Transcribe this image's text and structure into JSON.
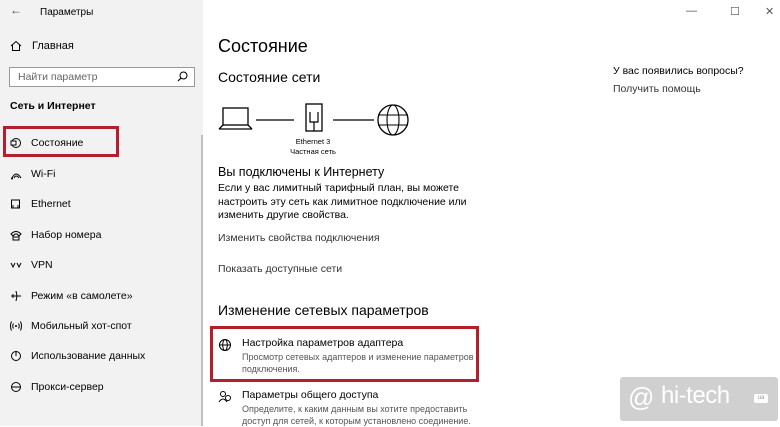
{
  "window": {
    "title": "Параметры",
    "controls": {
      "minimize": "—",
      "maximize": "☐",
      "close": "✕"
    }
  },
  "sidebar": {
    "home_label": "Главная",
    "search_placeholder": "Найти параметр",
    "section_title": "Сеть и Интернет",
    "items": [
      {
        "label": "Состояние",
        "icon": "status-icon",
        "selected": true
      },
      {
        "label": "Wi-Fi",
        "icon": "wifi-icon"
      },
      {
        "label": "Ethernet",
        "icon": "ethernet-icon"
      },
      {
        "label": "Набор номера",
        "icon": "dialup-icon"
      },
      {
        "label": "VPN",
        "icon": "vpn-icon"
      },
      {
        "label": "Режим «в самолете»",
        "icon": "airplane-icon"
      },
      {
        "label": "Мобильный хот-спот",
        "icon": "hotspot-icon"
      },
      {
        "label": "Использование данных",
        "icon": "data-usage-icon"
      },
      {
        "label": "Прокси-сервер",
        "icon": "proxy-icon"
      }
    ],
    "highlight_color": "#b3202b"
  },
  "main": {
    "page_title": "Состояние",
    "network_status_title": "Состояние сети",
    "diagram": {
      "adapter_name": "Ethernet 3",
      "network_type": "Частная сеть"
    },
    "connected_title": "Вы подключены к Интернету",
    "connected_desc": "Если у вас лимитный тарифный план, вы можете настроить эту сеть как лимитное подключение или изменить другие свойства.",
    "links": {
      "change_props": "Изменить свойства подключения",
      "show_networks": "Показать доступные сети"
    },
    "change_settings_title": "Изменение сетевых параметров",
    "options": [
      {
        "title": "Настройка параметров адаптера",
        "desc": "Просмотр сетевых адаптеров и изменение параметров подключения.",
        "icon": "adapter-icon"
      },
      {
        "title": "Параметры общего доступа",
        "desc": "Определите, к каким данным вы хотите предоставить доступ для сетей, к которым установлено соединение.",
        "icon": "sharing-icon"
      }
    ]
  },
  "help": {
    "title": "У вас появились вопросы?",
    "link": "Получить помощь"
  },
  "watermark": {
    "at": "@",
    "text": "hi-tech",
    "badge": "ua"
  }
}
